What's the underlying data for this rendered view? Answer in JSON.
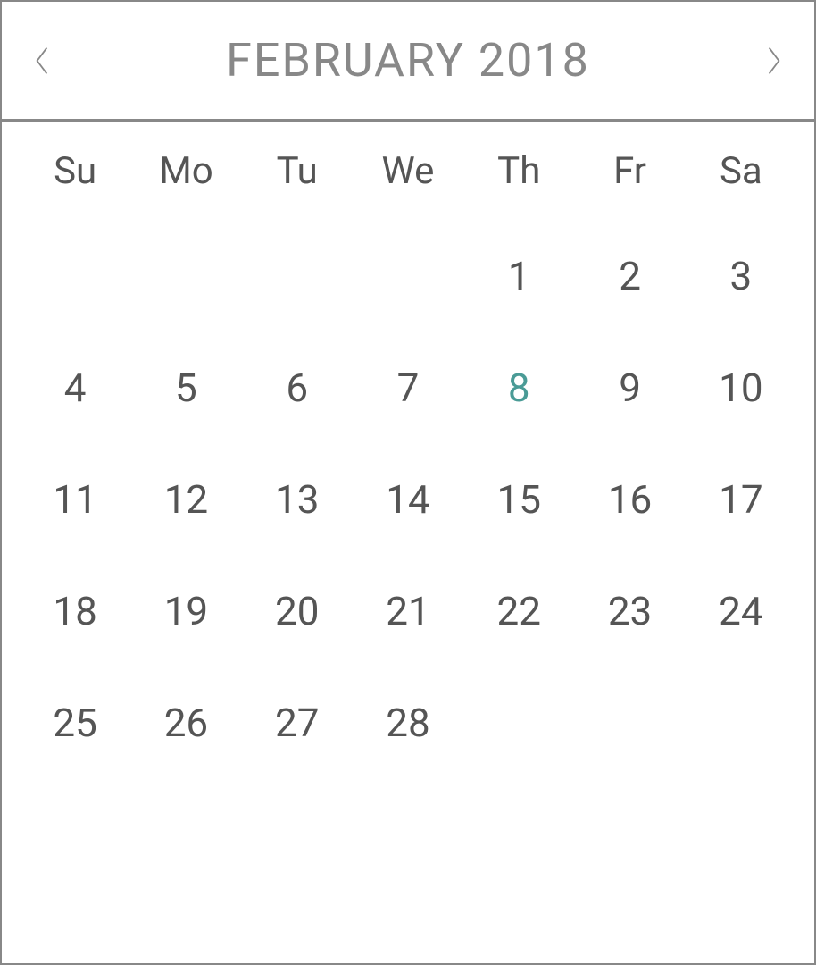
{
  "header": {
    "month_label": "FEBRUARY 2018"
  },
  "weekdays": [
    "Su",
    "Mo",
    "Tu",
    "We",
    "Th",
    "Fr",
    "Sa"
  ],
  "weeks": [
    [
      {
        "day": "",
        "today": false
      },
      {
        "day": "",
        "today": false
      },
      {
        "day": "",
        "today": false
      },
      {
        "day": "",
        "today": false
      },
      {
        "day": "1",
        "today": false
      },
      {
        "day": "2",
        "today": false
      },
      {
        "day": "3",
        "today": false
      }
    ],
    [
      {
        "day": "4",
        "today": false
      },
      {
        "day": "5",
        "today": false
      },
      {
        "day": "6",
        "today": false
      },
      {
        "day": "7",
        "today": false
      },
      {
        "day": "8",
        "today": true
      },
      {
        "day": "9",
        "today": false
      },
      {
        "day": "10",
        "today": false
      }
    ],
    [
      {
        "day": "11",
        "today": false
      },
      {
        "day": "12",
        "today": false
      },
      {
        "day": "13",
        "today": false
      },
      {
        "day": "14",
        "today": false
      },
      {
        "day": "15",
        "today": false
      },
      {
        "day": "16",
        "today": false
      },
      {
        "day": "17",
        "today": false
      }
    ],
    [
      {
        "day": "18",
        "today": false
      },
      {
        "day": "19",
        "today": false
      },
      {
        "day": "20",
        "today": false
      },
      {
        "day": "21",
        "today": false
      },
      {
        "day": "22",
        "today": false
      },
      {
        "day": "23",
        "today": false
      },
      {
        "day": "24",
        "today": false
      }
    ],
    [
      {
        "day": "25",
        "today": false
      },
      {
        "day": "26",
        "today": false
      },
      {
        "day": "27",
        "today": false
      },
      {
        "day": "28",
        "today": false
      },
      {
        "day": "",
        "today": false
      },
      {
        "day": "",
        "today": false
      },
      {
        "day": "",
        "today": false
      }
    ]
  ]
}
